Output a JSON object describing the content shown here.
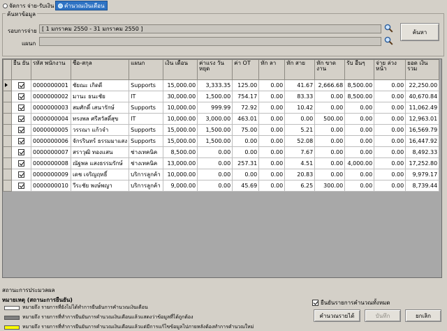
{
  "tabs": [
    {
      "label": "จัดการ จ่าย-รับเงิน",
      "active": false
    },
    {
      "label": "คำนวณเงินเดือน",
      "active": true
    }
  ],
  "search": {
    "group_title": "ค้นหาข้อมูล",
    "period_label": "รอบการจ่าย",
    "period_value": "[ 1 มกราคม 2550 - 31 มกราคม 2550 ]",
    "dept_label": "แผนก",
    "dept_value": "",
    "search_button": "ค้นหา"
  },
  "grid": {
    "columns": [
      "ยืน ยัน",
      "รหัส พนักงาน",
      "ชื่อ-สกุล",
      "แผนก",
      "เงิน เดือน",
      "ค่าแรง วันหยุด",
      "ค่า OT",
      "หัก ลา",
      "หัก สาย",
      "หัก ขาด งาน",
      "รับ อื่นๆ",
      "จ่าย ล่วง หน้า",
      "ยอด เงิน รวม"
    ],
    "rows": [
      {
        "confirmed": true,
        "id": "0000000001",
        "name": "ชัยณะ เกิดดี",
        "dept": "Supports",
        "salary": "15,000.00",
        "holiday": "3,333.35",
        "ot": "125.00",
        "leave": "0.00",
        "late": "41.67",
        "absent": "2,666.68",
        "other": "8,500.00",
        "advance": "0.00",
        "total": "22,250.00"
      },
      {
        "confirmed": true,
        "id": "0000000002",
        "name": "มานะ ธนะชัย",
        "dept": "IT",
        "salary": "30,000.00",
        "holiday": "1,500.00",
        "ot": "754.17",
        "leave": "0.00",
        "late": "83.33",
        "absent": "0.00",
        "other": "8,500.00",
        "advance": "0.00",
        "total": "40,670.84"
      },
      {
        "confirmed": true,
        "id": "0000000003",
        "name": "สมศักดิ์ เสนารักษ์",
        "dept": "Supports",
        "salary": "10,000.00",
        "holiday": "999.99",
        "ot": "72.92",
        "leave": "0.00",
        "late": "10.42",
        "absent": "0.00",
        "other": "0.00",
        "advance": "0.00",
        "total": "11,062.49"
      },
      {
        "confirmed": true,
        "id": "0000000004",
        "name": "ทรงพล ศรีสวัสดิ์สุข",
        "dept": "IT",
        "salary": "10,000.00",
        "holiday": "3,000.00",
        "ot": "463.01",
        "leave": "0.00",
        "late": "0.00",
        "absent": "500.00",
        "other": "0.00",
        "advance": "0.00",
        "total": "12,963.01"
      },
      {
        "confirmed": true,
        "id": "0000000005",
        "name": "วรรณา แก้วจำ",
        "dept": "Supports",
        "salary": "15,000.00",
        "holiday": "1,500.00",
        "ot": "75.00",
        "leave": "0.00",
        "late": "5.21",
        "absent": "0.00",
        "other": "0.00",
        "advance": "0.00",
        "total": "16,569.79"
      },
      {
        "confirmed": true,
        "id": "0000000006",
        "name": "จักรรินทร์ ธรรมมาแสง",
        "dept": "Supports",
        "salary": "15,000.00",
        "holiday": "1,500.00",
        "ot": "0.00",
        "leave": "0.00",
        "late": "52.08",
        "absent": "0.00",
        "other": "0.00",
        "advance": "0.00",
        "total": "16,447.92"
      },
      {
        "confirmed": true,
        "id": "0000000007",
        "name": "สราวุฒิ ทองแสน",
        "dept": "ช่างเทคนิค",
        "salary": "8,500.00",
        "holiday": "0.00",
        "ot": "0.00",
        "leave": "0.00",
        "late": "7.67",
        "absent": "0.00",
        "other": "0.00",
        "advance": "0.00",
        "total": "8,492.33"
      },
      {
        "confirmed": true,
        "id": "0000000008",
        "name": "ณัฐพล แสงธรรมรักษ์",
        "dept": "ช่างเทคนิค",
        "salary": "13,000.00",
        "holiday": "0.00",
        "ot": "257.31",
        "leave": "0.00",
        "late": "4.51",
        "absent": "0.00",
        "other": "4,000.00",
        "advance": "0.00",
        "total": "17,252.80"
      },
      {
        "confirmed": true,
        "id": "0000000009",
        "name": "เดช เจริญฤทธิ์",
        "dept": "บริการลูกค้า",
        "salary": "10,000.00",
        "holiday": "0.00",
        "ot": "0.00",
        "leave": "0.00",
        "late": "20.83",
        "absent": "0.00",
        "other": "0.00",
        "advance": "0.00",
        "total": "9,979.17"
      },
      {
        "confirmed": true,
        "id": "0000000010",
        "name": "วีระชัย พงษ์พญา",
        "dept": "บริการลูกค้า",
        "salary": "9,000.00",
        "holiday": "0.00",
        "ot": "45.69",
        "leave": "0.00",
        "late": "6.25",
        "absent": "300.00",
        "other": "0.00",
        "advance": "0.00",
        "total": "8,739.44"
      }
    ]
  },
  "status_text": "สถานะการประมวลผล",
  "legend": {
    "title": "หมายเหตุ (สถานะการยืนยัน)",
    "items": [
      {
        "color": "#ffffff",
        "text": "หมายถึง รายการที่ยังไม่ได้ทำการยืนยันการคำนวณเงินเดือน"
      },
      {
        "color": "#808080",
        "text": "หมายถึง รายการที่ทำการยืนยันการคำนวณเงินเดือนแล้วแสดงว่าข้อมูลที่ได้ถูกต้อง"
      },
      {
        "color": "#ffff00",
        "text": "หมายถึง รายการที่ทำการยืนยันการคำนวณเงินเดือนแล้วแต่มีการแก้ไขข้อมูลไปภายหลังต้องทำการคำนวณใหม่"
      }
    ]
  },
  "confirm_all_label": "ยืนยันรายการคำนวณทั้งหมด",
  "confirm_all_checked": true,
  "buttons": {
    "calculate": "คำนวณรายได้",
    "save": "บันทึก",
    "cancel": "ยกเลิก"
  }
}
